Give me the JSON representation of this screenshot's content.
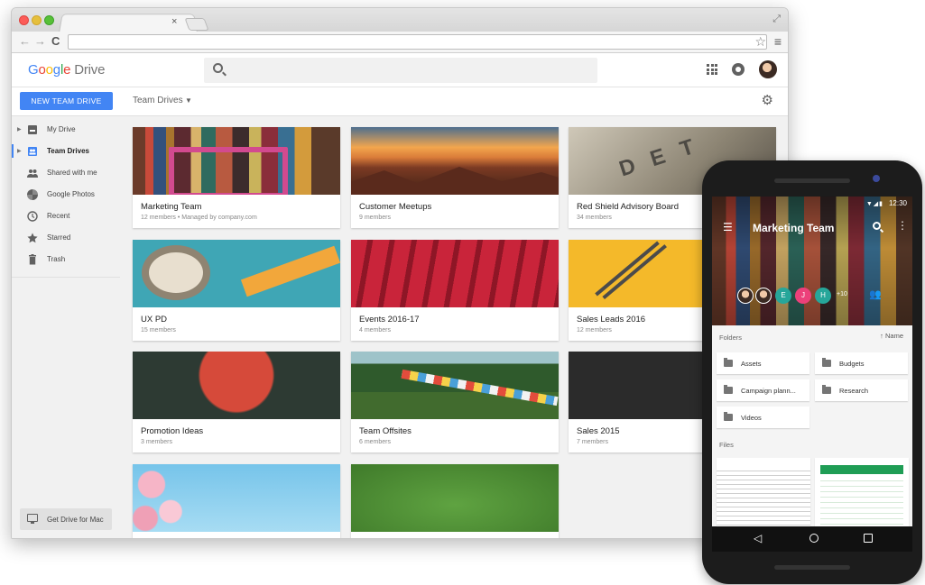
{
  "browser": {
    "tab_close": "×",
    "nav_back": "←",
    "nav_forward": "→",
    "nav_reload": "C"
  },
  "app": {
    "logo_google": [
      "G",
      "o",
      "o",
      "g",
      "l",
      "e"
    ],
    "logo_product": "Drive",
    "new_button": "NEW TEAM DRIVE",
    "breadcrumb": "Team Drives",
    "colors": {
      "accent": "#4285f4",
      "active": "#4285f4"
    }
  },
  "sidebar": {
    "items": [
      {
        "label": "My Drive",
        "icon": "drive-icon",
        "expand": true
      },
      {
        "label": "Team Drives",
        "icon": "team-drives-icon",
        "expand": true,
        "active": true
      },
      {
        "label": "Shared with me",
        "icon": "people-icon"
      },
      {
        "label": "Google Photos",
        "icon": "photos-icon"
      },
      {
        "label": "Recent",
        "icon": "clock-icon"
      },
      {
        "label": "Starred",
        "icon": "star-icon"
      },
      {
        "label": "Trash",
        "icon": "trash-icon"
      }
    ],
    "get_drive": "Get Drive for Mac"
  },
  "drives": [
    {
      "name": "Marketing Team",
      "meta": "12 members  •  Managed by company.com"
    },
    {
      "name": "Customer Meetups",
      "meta": "9 members"
    },
    {
      "name": "Red Shield Advisory Board",
      "meta": "34 members"
    },
    {
      "name": "UX PD",
      "meta": "15 members"
    },
    {
      "name": "Events 2016-17",
      "meta": "4 members"
    },
    {
      "name": "Sales Leads 2016",
      "meta": "12 members"
    },
    {
      "name": "Promotion Ideas",
      "meta": "3 members"
    },
    {
      "name": "Team Offsites",
      "meta": "6 members"
    },
    {
      "name": "Sales 2015",
      "meta": "7 members"
    },
    {
      "name": "",
      "meta": ""
    },
    {
      "name": "",
      "meta": ""
    }
  ],
  "phone": {
    "status_icons": "▼◢▮",
    "time": "12:30",
    "title": "Marketing Team",
    "members": [
      "E",
      "J",
      "H"
    ],
    "members_more": "+10",
    "folders_header": "Folders",
    "sort_label": "↑ Name",
    "folders": [
      "Assets",
      "Budgets",
      "Campaign plann...",
      "Research",
      "Videos"
    ],
    "files_header": "Files",
    "nav_back": "◁"
  }
}
